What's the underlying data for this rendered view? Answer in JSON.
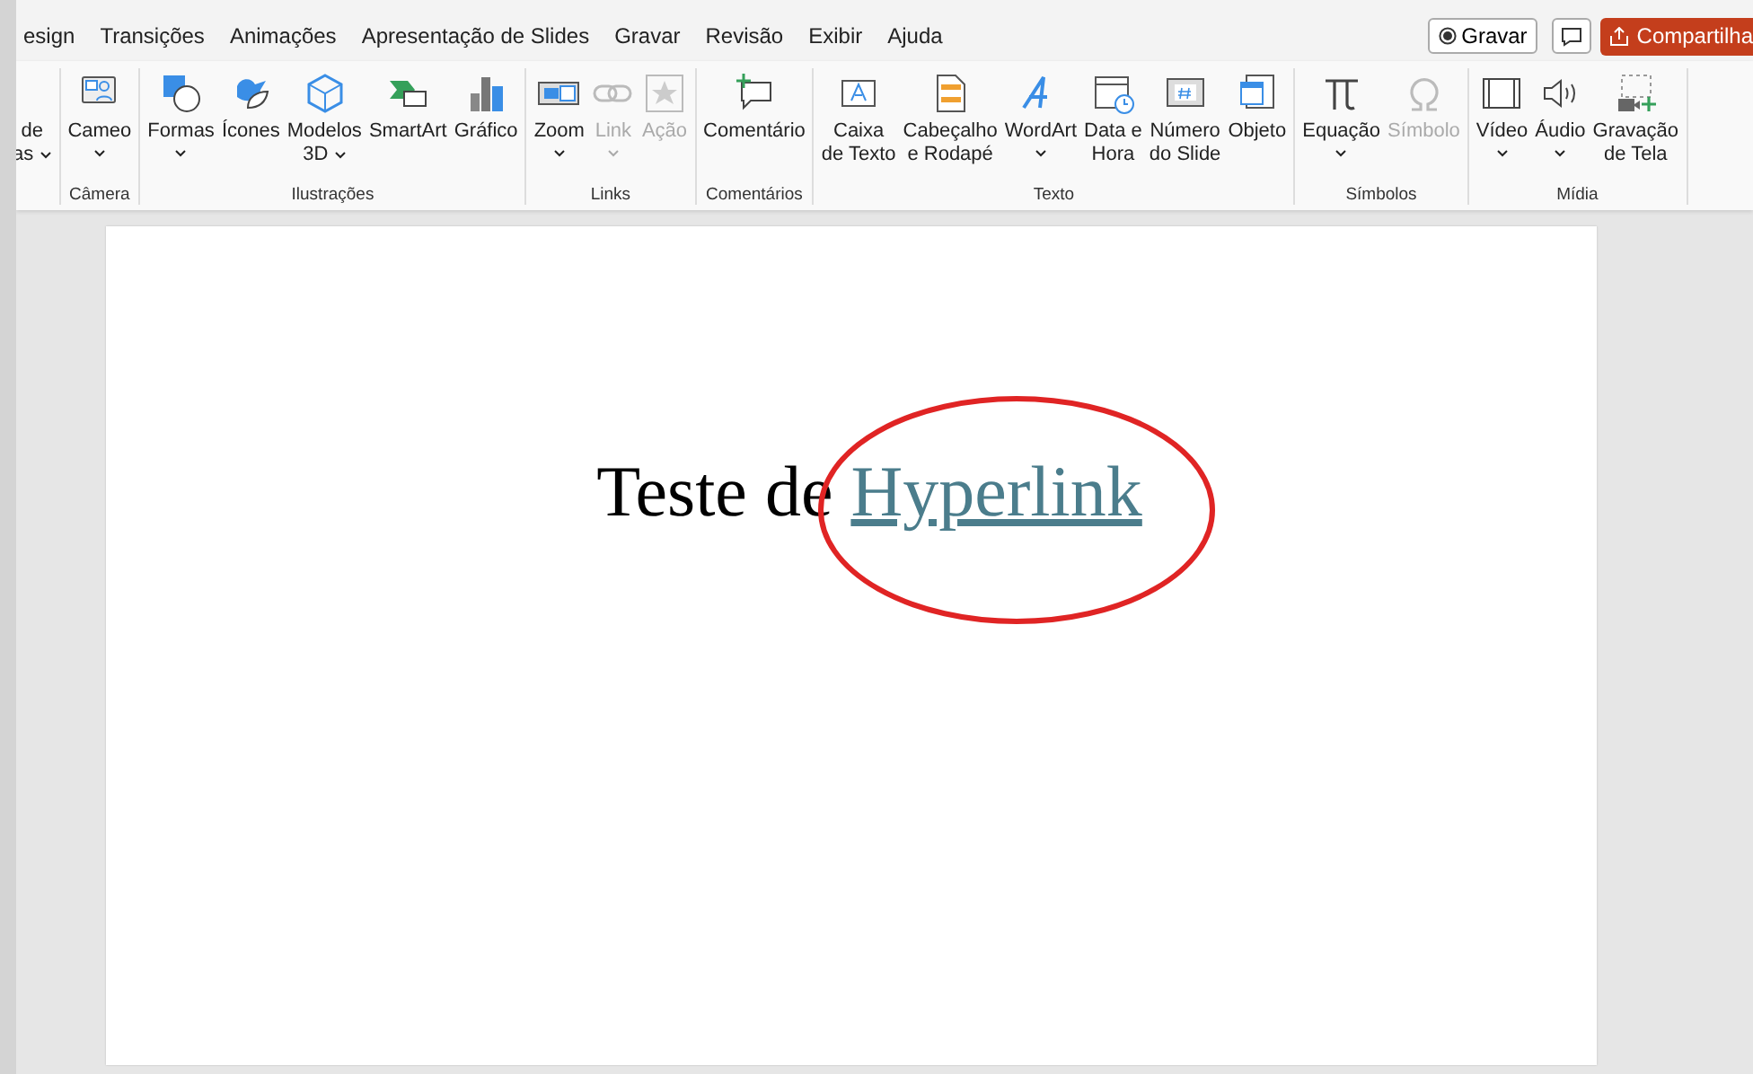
{
  "menu_tabs": [
    {
      "label": "esign",
      "selected": false
    },
    {
      "label": "Transições",
      "selected": false
    },
    {
      "label": "Animações",
      "selected": false
    },
    {
      "label": "Apresentação de Slides",
      "selected": false
    },
    {
      "label": "Gravar",
      "selected": false
    },
    {
      "label": "Revisão",
      "selected": false
    },
    {
      "label": "Exibir",
      "selected": false
    },
    {
      "label": "Ajuda",
      "selected": false
    }
  ],
  "title_actions": {
    "record": "Gravar",
    "share": "Compartilha"
  },
  "ribbon_groups": [
    {
      "buttons": [
        {
          "lines": [
            "de",
            "as"
          ],
          "caret": true,
          "disabled": false
        }
      ]
    },
    {
      "label": "Câmera",
      "buttons": [
        {
          "lines": [
            "Cameo"
          ],
          "caret": true,
          "disabled": false
        }
      ]
    },
    {
      "label": "Ilustrações",
      "buttons": [
        {
          "lines": [
            "Formas"
          ],
          "caret": true,
          "disabled": false
        },
        {
          "lines": [
            "Ícones"
          ],
          "caret": false,
          "disabled": false
        },
        {
          "lines": [
            "Modelos",
            "3D"
          ],
          "caret": true,
          "disabled": false
        },
        {
          "lines": [
            "SmartArt"
          ],
          "caret": false,
          "disabled": false
        },
        {
          "lines": [
            "Gráfico"
          ],
          "caret": false,
          "disabled": false
        }
      ]
    },
    {
      "label": "Links",
      "buttons": [
        {
          "lines": [
            "Zoom"
          ],
          "caret": true,
          "disabled": false
        },
        {
          "lines": [
            "Link"
          ],
          "caret": true,
          "disabled": true
        },
        {
          "lines": [
            "Ação"
          ],
          "caret": false,
          "disabled": true
        }
      ]
    },
    {
      "label": "Comentários",
      "buttons": [
        {
          "lines": [
            "Comentário"
          ],
          "caret": false,
          "disabled": false
        }
      ]
    },
    {
      "label": "Texto",
      "buttons": [
        {
          "lines": [
            "Caixa",
            "de Texto"
          ],
          "caret": false,
          "disabled": false
        },
        {
          "lines": [
            "Cabeçalho",
            "e Rodapé"
          ],
          "caret": false,
          "disabled": false
        },
        {
          "lines": [
            "WordArt"
          ],
          "caret": true,
          "disabled": false
        },
        {
          "lines": [
            "Data e",
            "Hora"
          ],
          "caret": false,
          "disabled": false
        },
        {
          "lines": [
            "Número",
            "do Slide"
          ],
          "caret": false,
          "disabled": false
        },
        {
          "lines": [
            "Objeto"
          ],
          "caret": false,
          "disabled": false
        }
      ]
    },
    {
      "label": "Símbolos",
      "buttons": [
        {
          "lines": [
            "Equação"
          ],
          "caret": true,
          "disabled": false
        },
        {
          "lines": [
            "Símbolo"
          ],
          "caret": false,
          "disabled": true
        }
      ]
    },
    {
      "label": "Mídia",
      "buttons": [
        {
          "lines": [
            "Vídeo"
          ],
          "caret": true,
          "disabled": false
        },
        {
          "lines": [
            "Áudio"
          ],
          "caret": true,
          "disabled": false
        },
        {
          "lines": [
            "Gravação",
            "de Tela"
          ],
          "caret": false,
          "disabled": false
        }
      ]
    }
  ],
  "slide": {
    "text": "Teste de ",
    "link": "Hyperlink",
    "annotation": {
      "kind": "ellipse",
      "color": "#e02424"
    }
  }
}
